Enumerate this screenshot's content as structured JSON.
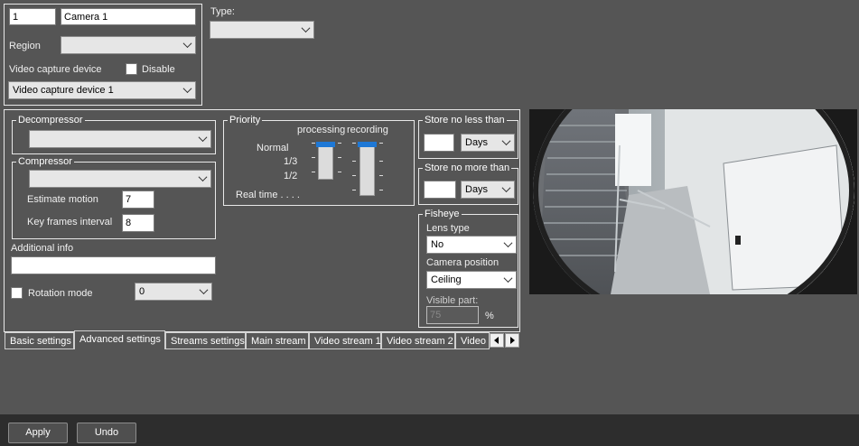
{
  "camera": {
    "id": "1",
    "name": "Camera 1",
    "region_label": "Region",
    "region_value": "",
    "video_capture_label": "Video capture device",
    "disable_label": "Disable",
    "video_capture_value": "Video capture device 1"
  },
  "type": {
    "label": "Type:",
    "value": ""
  },
  "decompressor": {
    "title": "Decompressor",
    "value": ""
  },
  "compressor": {
    "title": "Compressor",
    "value": "",
    "estimate_motion_label": "Estimate motion",
    "estimate_motion_value": "7",
    "key_frames_label": "Key frames interval",
    "key_frames_value": "8"
  },
  "additional_info": {
    "label": "Additional info",
    "value": ""
  },
  "rotation": {
    "label": "Rotation mode",
    "value": "0"
  },
  "priority": {
    "title": "Priority",
    "processing_label": "processing",
    "recording_label": "recording",
    "levels": [
      "Normal",
      "1/3",
      "1/2",
      "Real time . . . ."
    ],
    "processing_level": 0,
    "recording_level": 0
  },
  "store_min": {
    "title": "Store no less than",
    "value": "",
    "unit": "Days"
  },
  "store_max": {
    "title": "Store no more than",
    "value": "",
    "unit": "Days"
  },
  "fisheye": {
    "title": "Fisheye",
    "lens_type_label": "Lens type",
    "lens_type_value": "No",
    "camera_position_label": "Camera position",
    "camera_position_value": "Ceiling",
    "visible_part_label": "Visible part:",
    "visible_part_value": "75",
    "visible_part_unit": "%"
  },
  "tabs": [
    "Basic settings",
    "Advanced settings",
    "Streams settings",
    "Main stream",
    "Video stream 1",
    "Video stream 2",
    "Video"
  ],
  "footer": {
    "apply_label": "Apply",
    "undo_label": "Undo"
  },
  "colors": {
    "background": "#555555",
    "footer": "#2d2d2d",
    "accent": "#1e78d6"
  }
}
